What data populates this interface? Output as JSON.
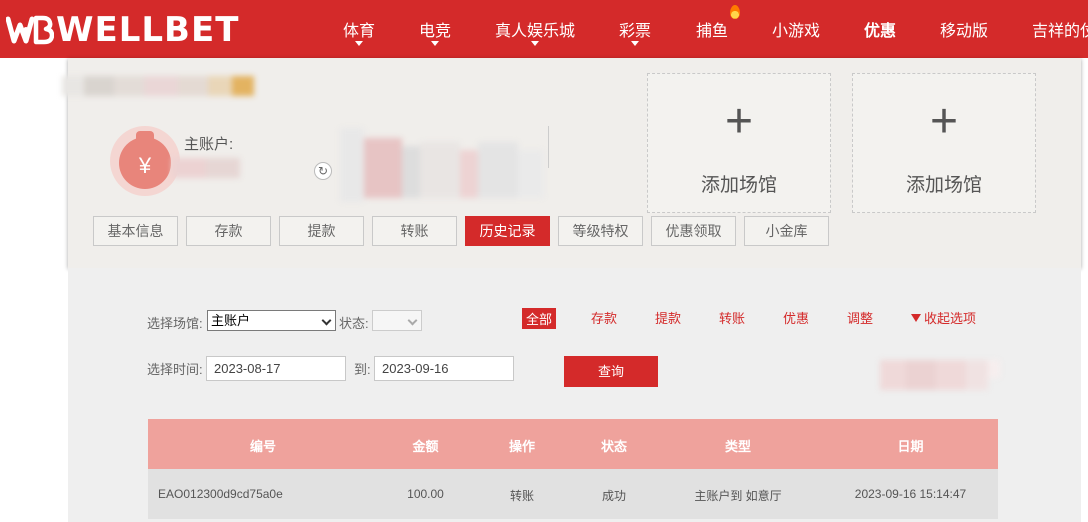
{
  "brand": {
    "name": "WELLBET",
    "accent": "#d42a2a"
  },
  "nav": {
    "items": [
      {
        "label": "体育",
        "has_caret": true
      },
      {
        "label": "电竞",
        "has_caret": true
      },
      {
        "label": "真人娱乐城",
        "has_caret": true
      },
      {
        "label": "彩票",
        "has_caret": true
      },
      {
        "label": "捕鱼",
        "has_caret": false,
        "icon": "fire-icon"
      },
      {
        "label": "小游戏",
        "has_caret": false
      },
      {
        "label": "优惠",
        "has_caret": false,
        "bold": true
      },
      {
        "label": "移动版",
        "has_caret": false
      },
      {
        "label": "吉祥的仗",
        "has_caret": false
      }
    ]
  },
  "account": {
    "main_label": "主账户:",
    "add_venue_label": "添加场馆"
  },
  "tabs": [
    {
      "label": "基本信息"
    },
    {
      "label": "存款"
    },
    {
      "label": "提款"
    },
    {
      "label": "转账"
    },
    {
      "label": "历史记录",
      "active": true
    },
    {
      "label": "等级特权"
    },
    {
      "label": "优惠领取"
    },
    {
      "label": "小金库"
    }
  ],
  "filters": {
    "venue_label": "选择场馆:",
    "venue_value": "主账户",
    "status_label": "状态:",
    "time_label": "选择时间:",
    "to_label": "到:",
    "date_from": "2023-08-17",
    "date_to": "2023-09-16",
    "query_label": "查询",
    "types": [
      {
        "label": "全部",
        "active": true
      },
      {
        "label": "存款"
      },
      {
        "label": "提款"
      },
      {
        "label": "转账"
      },
      {
        "label": "优惠"
      },
      {
        "label": "调整"
      }
    ],
    "collapse_label": "收起选项"
  },
  "table": {
    "headers": [
      "编号",
      "金额",
      "操作",
      "状态",
      "类型",
      "日期"
    ],
    "rows": [
      [
        "EAO012300d9cd75a0e",
        "100.00",
        "转账",
        "成功",
        "主账户到 如意厅",
        "2023-09-16 15:14:47"
      ]
    ]
  }
}
